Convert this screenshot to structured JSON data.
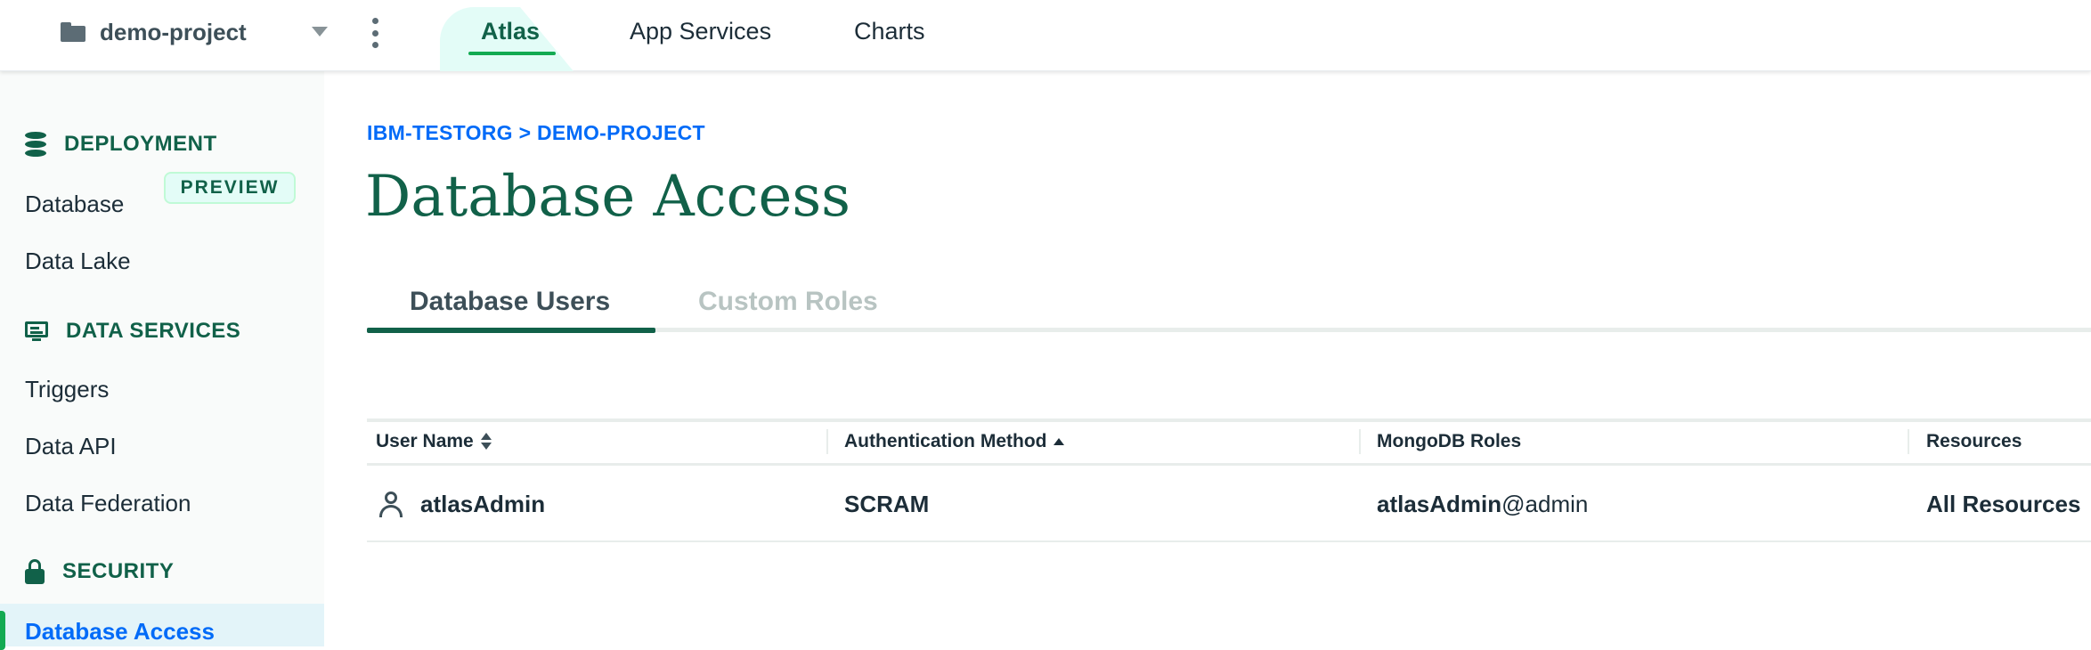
{
  "topbar": {
    "project_name": "demo-project",
    "nav": [
      "Atlas",
      "App Services",
      "Charts"
    ],
    "active_nav": "Atlas"
  },
  "sidebar": {
    "sections": [
      {
        "title": "DEPLOYMENT",
        "icon": "database-icon"
      },
      {
        "title": "DATA SERVICES",
        "icon": "monitor-icon"
      },
      {
        "title": "SECURITY",
        "icon": "lock-icon"
      }
    ],
    "items": {
      "database": "Database",
      "data_lake": "Data Lake",
      "data_lake_badge": "PREVIEW",
      "triggers": "Triggers",
      "data_api": "Data API",
      "data_federation": "Data Federation",
      "database_access": "Database Access"
    }
  },
  "main": {
    "breadcrumb": "IBM-TESTORG > DEMO-PROJECT",
    "title": "Database Access",
    "tabs": [
      "Database Users",
      "Custom Roles"
    ],
    "active_tab": "Database Users",
    "table": {
      "columns": [
        "User Name",
        "Authentication Method",
        "MongoDB Roles",
        "Resources"
      ],
      "rows": [
        {
          "user_name": "atlasAdmin",
          "auth_method": "SCRAM",
          "role_user": "atlasAdmin",
          "role_db": "@admin",
          "resources": "All Resources"
        }
      ]
    }
  },
  "colors": {
    "brand_green": "#116149",
    "accent_green": "#13aa52",
    "link_blue": "#016bf8"
  }
}
